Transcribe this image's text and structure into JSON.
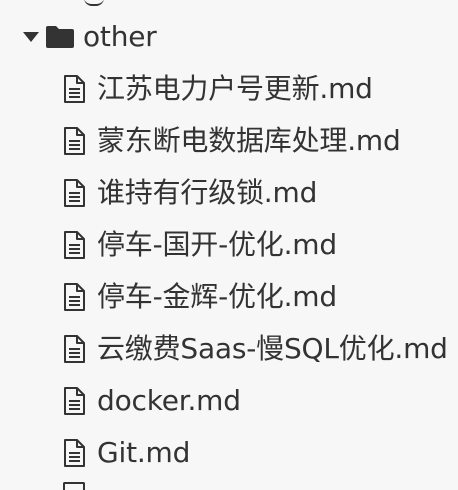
{
  "folder": {
    "name": "other",
    "icon": "folder-icon",
    "expanded_icon": "caret-down-icon"
  },
  "files": [
    {
      "name": "江苏电力户号更新.md",
      "icon": "file-icon"
    },
    {
      "name": "蒙东断电数据库处理.md",
      "icon": "file-icon"
    },
    {
      "name": "谁持有行级锁.md",
      "icon": "file-icon"
    },
    {
      "name": "停车-国开-优化.md",
      "icon": "file-icon"
    },
    {
      "name": "停车-金辉-优化.md",
      "icon": "file-icon"
    },
    {
      "name": "云缴费Saas-慢SQL优化.md",
      "icon": "file-icon"
    },
    {
      "name": "docker.md",
      "icon": "file-icon"
    },
    {
      "name": "Git.md",
      "icon": "file-icon"
    }
  ],
  "colors": {
    "background": "#f7f7f7",
    "text": "#333333"
  }
}
